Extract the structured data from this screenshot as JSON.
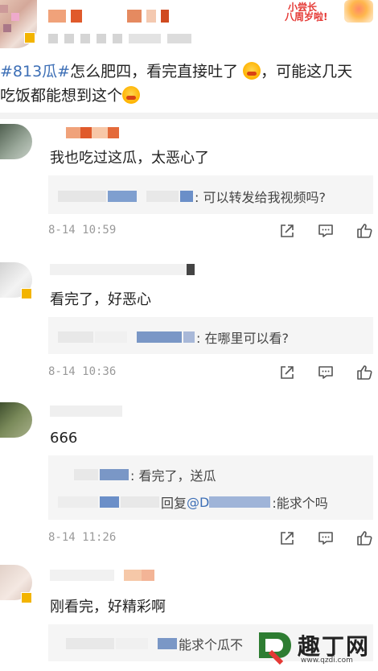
{
  "post": {
    "hashtag": "#813瓜#",
    "text_line1": "怎么肥四，看完直接吐了",
    "text_line1b": "，可能这几天",
    "text_line2": "吃饭都能想到这个",
    "sticker_line1": "小尝长",
    "sticker_line2": "八周岁啦!"
  },
  "comments": [
    {
      "text": "我也吃过这瓜，太恶心了",
      "replies": [
        {
          "text": ": 可以转发给我视频吗?"
        }
      ],
      "time": "8-14 10:59"
    },
    {
      "text": "看完了，好恶心",
      "replies": [
        {
          "text": ": 在哪里可以看?"
        }
      ],
      "time": "8-14 10:36"
    },
    {
      "text": "666",
      "replies": [
        {
          "text": ": 看完了，送瓜"
        },
        {
          "prefix": "回复",
          "mention": "@D",
          "text": ":能求个吗"
        }
      ],
      "time": "8-14 11:26"
    },
    {
      "text": "刚看完，好精彩啊",
      "replies": [
        {
          "text": "能求个瓜不"
        }
      ]
    }
  ],
  "watermark": {
    "title": "趣丁网",
    "url": "www.qzdi.com"
  },
  "icons": [
    "share-icon",
    "comment-icon",
    "like-icon"
  ],
  "colors": {
    "link": "#3d6fb6",
    "badge": "#f3b400",
    "reply_bg": "#f5f5f5",
    "time": "#9a9a9a"
  }
}
